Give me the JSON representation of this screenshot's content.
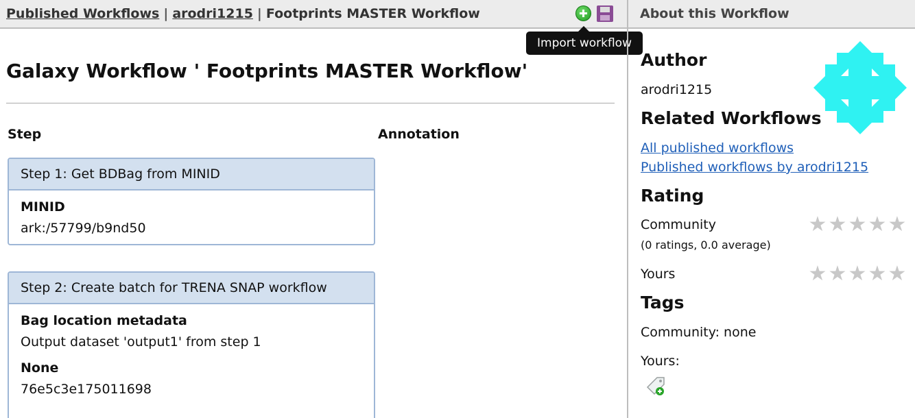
{
  "breadcrumb": {
    "published_workflows": "Published Workflows",
    "separator": "|",
    "user": "arodri1215",
    "current": "Footprints MASTER Workflow"
  },
  "toolbar": {
    "import_icon": "plus-circle-icon",
    "save_icon": "floppy-disk-icon",
    "tooltip": "Import workflow"
  },
  "main": {
    "title": "Galaxy Workflow ' Footprints MASTER Workflow'",
    "columns": {
      "step": "Step",
      "annotation": "Annotation"
    },
    "steps": [
      {
        "title": "Step 1: Get BDBag from MINID",
        "params": [
          {
            "label": "MINID",
            "value": "ark:/57799/b9nd50"
          }
        ]
      },
      {
        "title": "Step 2: Create batch for TRENA SNAP workflow",
        "params": [
          {
            "label": "Bag location metadata",
            "value": "Output dataset 'output1' from step 1"
          },
          {
            "label": "None",
            "value": "76e5c3e175011698"
          }
        ]
      }
    ]
  },
  "sidebar": {
    "title": "About this Workflow",
    "author_heading": "Author",
    "author": "arodri1215",
    "related_heading": "Related Workflows",
    "related_links": [
      "All published workflows",
      "Published workflows by arodri1215"
    ],
    "rating_heading": "Rating",
    "community_label": "Community",
    "community_summary": "(0 ratings, 0.0 average)",
    "yours_label": "Yours",
    "community_stars": 0,
    "your_stars": 0,
    "tags_heading": "Tags",
    "tags_community": "Community: none",
    "tags_yours": "Yours:",
    "tag_icon": "add-tag-icon",
    "avatar_color": "#2ff2f2"
  }
}
